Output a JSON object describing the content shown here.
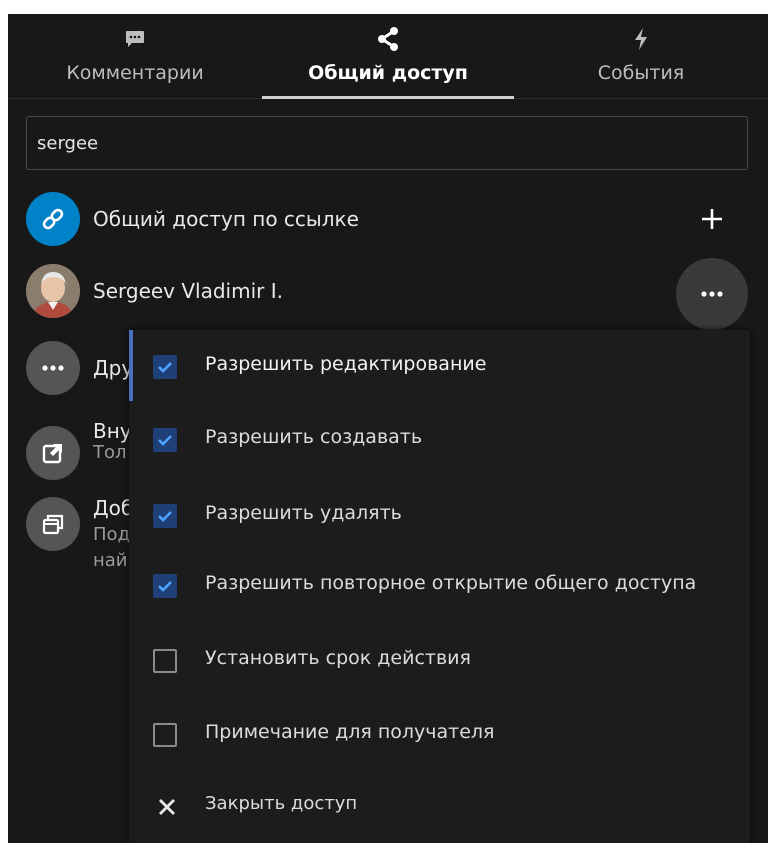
{
  "tabs": [
    {
      "label": "Комментарии",
      "icon": "comment-icon",
      "active": false
    },
    {
      "label": "Общий доступ",
      "icon": "share-icon",
      "active": true
    },
    {
      "label": "События",
      "icon": "activity-icon",
      "active": false
    }
  ],
  "search": {
    "value": "sergee"
  },
  "share_list": [
    {
      "label": "Общий доступ по ссылке",
      "icon": "link-icon",
      "action_icon": "plus-icon"
    },
    {
      "label": "Sergeev Vladimir I.",
      "icon": "avatar-photo",
      "action_icon": "more-icon"
    },
    {
      "label": "Дру",
      "icon": "more-icon"
    },
    {
      "label": "Вну",
      "sub": "Тол",
      "icon": "external-link-icon"
    },
    {
      "label": "Доб",
      "sub": "Под",
      "sub2": "най",
      "icon": "files-icon"
    }
  ],
  "menu": {
    "items": [
      {
        "label": "Разрешить редактирование",
        "checked": true
      },
      {
        "label": "Разрешить создавать",
        "checked": true
      },
      {
        "label": "Разрешить удалять",
        "checked": true
      },
      {
        "label": "Разрешить повторное открытие общего доступа",
        "checked": true
      },
      {
        "label": "Установить срок действия",
        "checked": false
      },
      {
        "label": "Примечание для получателя",
        "checked": false
      }
    ],
    "close_label": "Закрыть доступ"
  },
  "colors": {
    "panel_bg": "#181818",
    "accent": "#0082c9",
    "checkbox_checked": "#1f3f77",
    "menu_accent": "#4c6fc0"
  }
}
